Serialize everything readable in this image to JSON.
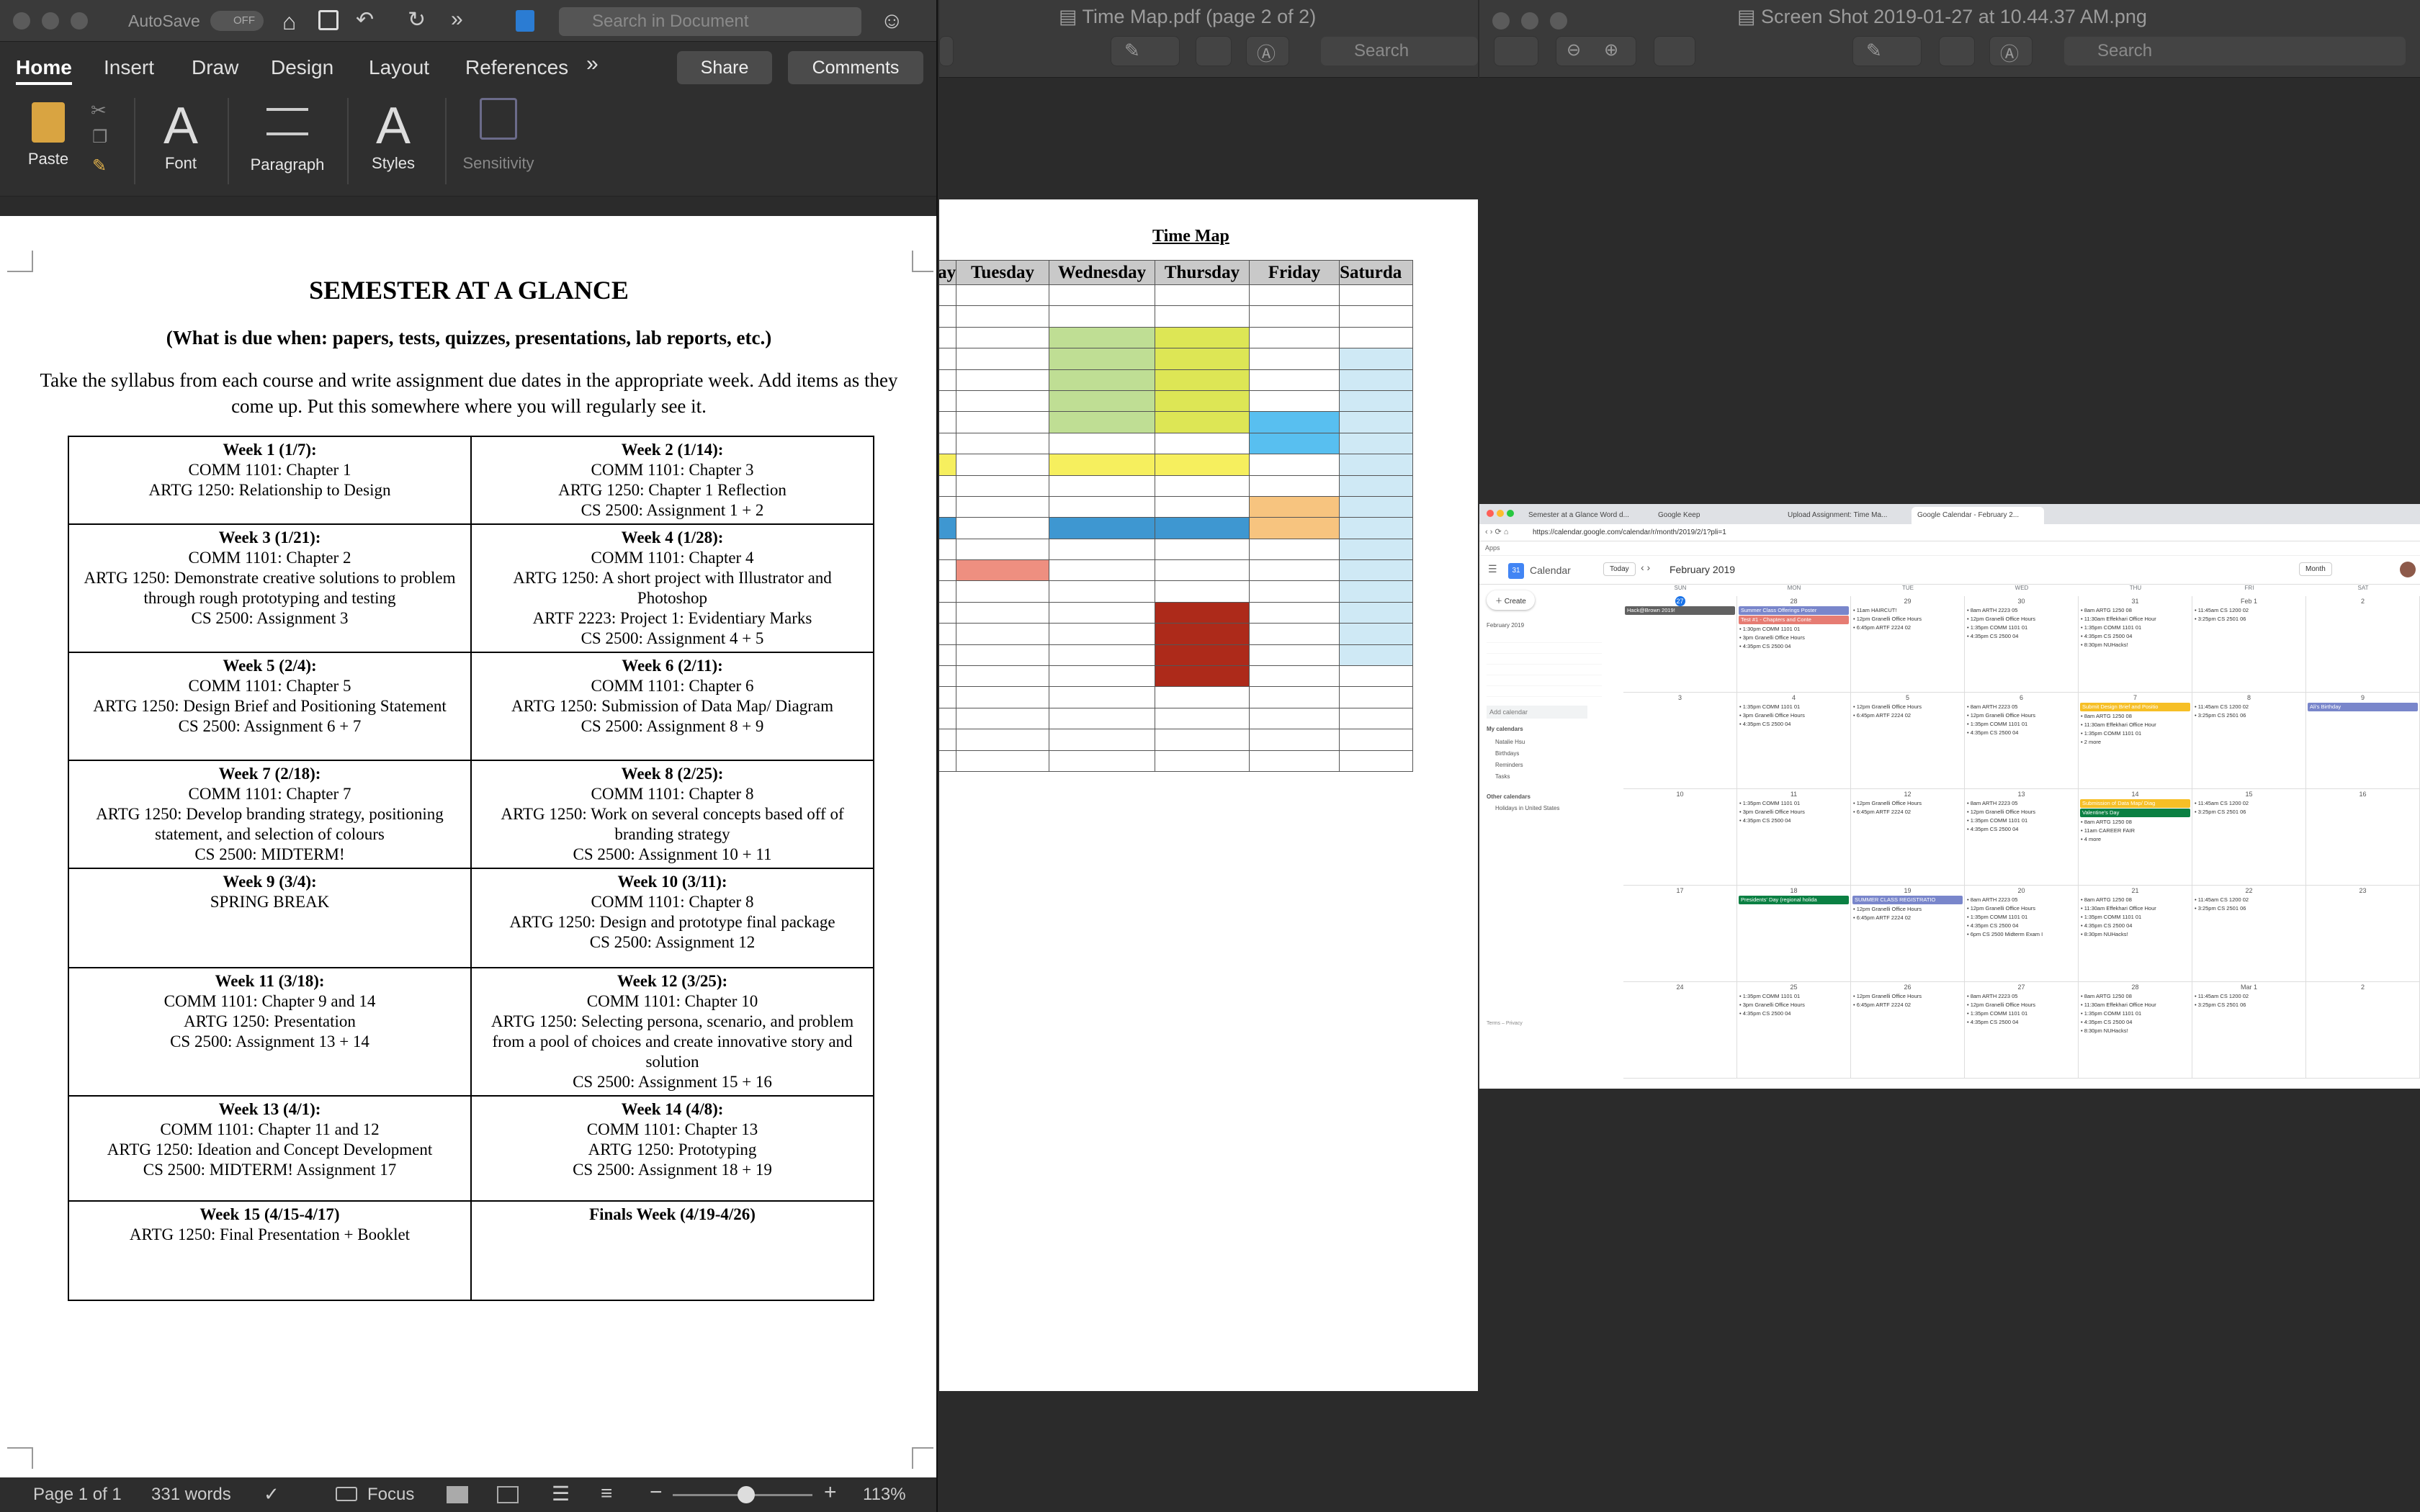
{
  "word": {
    "autosave": "AutoSave",
    "autosave_state": "OFF",
    "search_placeholder": "Search in Document",
    "tabs": [
      "Home",
      "Insert",
      "Draw",
      "Design",
      "Layout",
      "References"
    ],
    "share": "Share",
    "comments": "Comments",
    "ribbon": {
      "paste": "Paste",
      "font": "Font",
      "paragraph": "Paragraph",
      "styles": "Styles",
      "sensitivity": "Sensitivity"
    },
    "doc": {
      "title": "SEMESTER AT A GLANCE",
      "subtitle": "(What is due when:  papers, tests, quizzes, presentations, lab reports, etc.)",
      "intro": "Take the syllabus from each course and write assignment due dates in the appropriate week.  Add items as they come up.  Put this somewhere where you will regularly see it.",
      "weeks": [
        {
          "head": "Week 1 (1/7):",
          "lines": [
            "COMM 1101: Chapter 1",
            "ARTG 1250: Relationship to Design"
          ]
        },
        {
          "head": "Week 2 (1/14):",
          "lines": [
            "COMM 1101: Chapter 3",
            "ARTG 1250: Chapter 1 Reflection",
            "CS 2500: Assignment 1 + 2"
          ]
        },
        {
          "head": "Week 3 (1/21):",
          "lines": [
            "COMM 1101: Chapter 2",
            "ARTG 1250: Demonstrate creative solutions to problem through rough prototyping and testing",
            "CS 2500: Assignment 3"
          ]
        },
        {
          "head": "Week 4 (1/28):",
          "lines": [
            "COMM 1101: Chapter 4",
            "ARTG 1250: A short project with Illustrator and Photoshop",
            "ARTF 2223: Project 1: Evidentiary Marks",
            "CS 2500: Assignment 4 + 5"
          ]
        },
        {
          "head": "Week 5 (2/4):",
          "lines": [
            "COMM 1101: Chapter 5",
            "ARTG 1250: Design Brief and Positioning Statement",
            "CS 2500: Assignment 6 + 7"
          ]
        },
        {
          "head": "Week 6 (2/11):",
          "lines": [
            "COMM 1101: Chapter 6",
            "ARTG 1250: Submission of Data Map/ Diagram",
            "CS 2500: Assignment 8 + 9"
          ]
        },
        {
          "head": "Week 7 (2/18):",
          "lines": [
            "COMM 1101: Chapter 7",
            "ARTG 1250: Develop branding strategy, positioning statement, and selection of colours",
            "CS 2500: MIDTERM!"
          ]
        },
        {
          "head": "Week 8 (2/25):",
          "lines": [
            "COMM 1101: Chapter 8",
            "ARTG 1250: Work on several concepts based off of branding strategy",
            "CS 2500: Assignment 10 + 11"
          ]
        },
        {
          "head": "Week 9 (3/4):",
          "lines": [
            "SPRING BREAK"
          ]
        },
        {
          "head": "Week 10 (3/11):",
          "lines": [
            "COMM 1101: Chapter 8",
            "ARTG 1250: Design and prototype final package",
            "CS 2500: Assignment 12"
          ]
        },
        {
          "head": "Week 11 (3/18):",
          "lines": [
            "COMM 1101: Chapter 9 and 14",
            "ARTG 1250: Presentation",
            "CS 2500: Assignment 13 + 14"
          ]
        },
        {
          "head": "Week 12 (3/25):",
          "lines": [
            "COMM 1101: Chapter 10",
            "ARTG 1250: Selecting persona, scenario, and problem from a pool of choices and create innovative story and solution",
            "CS 2500: Assignment 15 + 16"
          ]
        },
        {
          "head": "Week 13 (4/1):",
          "lines": [
            "COMM 1101: Chapter 11 and 12",
            "ARTG 1250: Ideation and Concept Development",
            "CS 2500: MIDTERM! Assignment 17"
          ]
        },
        {
          "head": "Week 14 (4/8):",
          "lines": [
            "COMM 1101: Chapter 13",
            "ARTG 1250: Prototyping",
            "CS 2500: Assignment 18 + 19"
          ]
        },
        {
          "head": "Week 15 (4/15-4/17)",
          "lines": [
            "ARTG 1250: Final Presentation + Booklet"
          ]
        },
        {
          "head": "Finals Week (4/19-4/26)",
          "lines": []
        }
      ]
    },
    "status": {
      "page": "Page 1 of 1",
      "words": "331 words",
      "focus": "Focus",
      "zoom": "113%"
    }
  },
  "pdf": {
    "window_title": "Time Map.pdf (page 2 of 2)",
    "search_placeholder": "Search",
    "page_title": "Time Map",
    "days": [
      "nday",
      "Tuesday",
      "Wednesday",
      "Thursday",
      "Friday",
      "Saturda"
    ],
    "colors": {
      "green": "#bfde94",
      "lime": "#dde655",
      "lightblue": "#cfe9f5",
      "skyblue": "#58bff0",
      "yellow": "#f6ef5e",
      "blue": "#3e97d1",
      "orange": "#f7c47f",
      "salmon": "#ee8f80",
      "red": "#ad2a1a"
    }
  },
  "preview": {
    "window_title": "Screen Shot 2019-01-27 at 10.44.37 AM.png",
    "search_placeholder": "Search",
    "browser_tabs": [
      "Semester at a Glance Word d...",
      "Google Keep",
      "Upload Assignment: Time Ma...",
      "Google Calendar - February 2..."
    ],
    "url": "https://calendar.google.com/calendar/r/month/2019/2/1?pli=1",
    "apps": "Apps",
    "calendar_label": "Calendar",
    "today": "Today",
    "month_title": "February 2019",
    "view": "Month",
    "create": "Create",
    "mini_month": "February 2019",
    "add_calendar": "Add calendar",
    "my_calendars": "My calendars",
    "my_cal_items": [
      "Natalie Hsu",
      "Birthdays",
      "Reminders",
      "Tasks"
    ],
    "other_calendars": "Other calendars",
    "other_items": [
      "Holidays in United States"
    ],
    "terms": "Terms – Privacy",
    "dow": [
      "SUN",
      "MON",
      "TUE",
      "WED",
      "THU",
      "FRI",
      "SAT"
    ],
    "weeks": [
      [
        {
          "d": "27",
          "ev": [
            {
              "t": "Hack@Brown 2019!",
              "b": "#616161"
            }
          ]
        },
        {
          "d": "28",
          "ev": [
            {
              "t": "Summer Class Offerings Poster",
              "b": "#7986cb"
            },
            {
              "t": "Test #1 - Chapters and Conte",
              "b": "#e67c73"
            },
            {
              "t": "1:30pm COMM 1101 01"
            },
            {
              "t": "3pm Granelli Office Hours"
            },
            {
              "t": "4:35pm CS 2500 04"
            }
          ]
        },
        {
          "d": "29",
          "ev": [
            {
              "t": "11am HAIRCUT!"
            },
            {
              "t": "12pm Granelli Office Hours"
            },
            {
              "t": "6:45pm ARTF 2224 02"
            }
          ]
        },
        {
          "d": "30",
          "ev": [
            {
              "t": "8am ARTH 2223 05"
            },
            {
              "t": "12pm Granelli Office Hours"
            },
            {
              "t": "1:35pm COMM 1101 01"
            },
            {
              "t": "4:35pm CS 2500 04"
            }
          ]
        },
        {
          "d": "31",
          "ev": [
            {
              "t": "8am ARTG 1250 08"
            },
            {
              "t": "11:30am Effekhari Office Hour"
            },
            {
              "t": "1:35pm COMM 1101 01"
            },
            {
              "t": "4:35pm CS 2500 04"
            },
            {
              "t": "8:30pm NUHacks!"
            }
          ]
        },
        {
          "d": "Feb 1",
          "ev": [
            {
              "t": "11:45am CS 1200 02"
            },
            {
              "t": "3:25pm CS 2501 06"
            }
          ]
        },
        {
          "d": "2",
          "ev": []
        }
      ],
      [
        {
          "d": "3",
          "ev": []
        },
        {
          "d": "4",
          "ev": [
            {
              "t": "1:35pm COMM 1101 01"
            },
            {
              "t": "3pm Granelli Office Hours"
            },
            {
              "t": "4:35pm CS 2500 04"
            }
          ]
        },
        {
          "d": "5",
          "ev": [
            {
              "t": "12pm Granelli Office Hours"
            },
            {
              "t": "6:45pm ARTF 2224 02"
            }
          ]
        },
        {
          "d": "6",
          "ev": [
            {
              "t": "8am ARTH 2223 05"
            },
            {
              "t": "12pm Granelli Office Hours"
            },
            {
              "t": "1:35pm COMM 1101 01"
            },
            {
              "t": "4:35pm CS 2500 04"
            }
          ]
        },
        {
          "d": "7",
          "ev": [
            {
              "t": "Submit Design Brief and Positio",
              "b": "#f6bf26"
            },
            {
              "t": "8am ARTG 1250 08"
            },
            {
              "t": "11:30am Effekhari Office Hour"
            },
            {
              "t": "1:35pm COMM 1101 01"
            },
            {
              "t": "2 more"
            }
          ]
        },
        {
          "d": "8",
          "ev": [
            {
              "t": "11:45am CS 1200 02"
            },
            {
              "t": "3:25pm CS 2501 06"
            }
          ]
        },
        {
          "d": "9",
          "ev": [
            {
              "t": "Ali's Birthday",
              "b": "#7986cb"
            }
          ]
        }
      ],
      [
        {
          "d": "10",
          "ev": []
        },
        {
          "d": "11",
          "ev": [
            {
              "t": "1:35pm COMM 1101 01"
            },
            {
              "t": "3pm Granelli Office Hours"
            },
            {
              "t": "4:35pm CS 2500 04"
            }
          ]
        },
        {
          "d": "12",
          "ev": [
            {
              "t": "12pm Granelli Office Hours"
            },
            {
              "t": "6:45pm ARTF 2224 02"
            }
          ]
        },
        {
          "d": "13",
          "ev": [
            {
              "t": "8am ARTH 2223 05"
            },
            {
              "t": "12pm Granelli Office Hours"
            },
            {
              "t": "1:35pm COMM 1101 01"
            },
            {
              "t": "4:35pm CS 2500 04"
            }
          ]
        },
        {
          "d": "14",
          "ev": [
            {
              "t": "Submission of Data Map/ Diag",
              "b": "#f6bf26"
            },
            {
              "t": "Valentine's Day",
              "b": "#0b8043"
            },
            {
              "t": "8am ARTG 1250 08"
            },
            {
              "t": "11am CAREER FAIR"
            },
            {
              "t": "4 more"
            }
          ]
        },
        {
          "d": "15",
          "ev": [
            {
              "t": "11:45am CS 1200 02"
            },
            {
              "t": "3:25pm CS 2501 06"
            }
          ]
        },
        {
          "d": "16",
          "ev": []
        }
      ],
      [
        {
          "d": "17",
          "ev": []
        },
        {
          "d": "18",
          "ev": [
            {
              "t": "Presidents' Day (regional holida",
              "b": "#0b8043"
            }
          ]
        },
        {
          "d": "19",
          "ev": [
            {
              "t": "SUMMER CLASS REGISTRATIO",
              "b": "#7986cb"
            },
            {
              "t": "12pm Granelli Office Hours"
            },
            {
              "t": "6:45pm ARTF 2224 02"
            }
          ]
        },
        {
          "d": "20",
          "ev": [
            {
              "t": "8am ARTH 2223 05"
            },
            {
              "t": "12pm Granelli Office Hours"
            },
            {
              "t": "1:35pm COMM 1101 01"
            },
            {
              "t": "4:35pm CS 2500 04"
            },
            {
              "t": "6pm CS 2500 Midterm Exam I"
            }
          ]
        },
        {
          "d": "21",
          "ev": [
            {
              "t": "8am ARTG 1250 08"
            },
            {
              "t": "11:30am Effekhari Office Hour"
            },
            {
              "t": "1:35pm COMM 1101 01"
            },
            {
              "t": "4:35pm CS 2500 04"
            },
            {
              "t": "8:30pm NUHacks!"
            }
          ]
        },
        {
          "d": "22",
          "ev": [
            {
              "t": "11:45am CS 1200 02"
            },
            {
              "t": "3:25pm CS 2501 06"
            }
          ]
        },
        {
          "d": "23",
          "ev": []
        }
      ],
      [
        {
          "d": "24",
          "ev": []
        },
        {
          "d": "25",
          "ev": [
            {
              "t": "1:35pm COMM 1101 01"
            },
            {
              "t": "3pm Granelli Office Hours"
            },
            {
              "t": "4:35pm CS 2500 04"
            }
          ]
        },
        {
          "d": "26",
          "ev": [
            {
              "t": "12pm Granelli Office Hours"
            },
            {
              "t": "6:45pm ARTF 2224 02"
            }
          ]
        },
        {
          "d": "27",
          "ev": [
            {
              "t": "8am ARTH 2223 05"
            },
            {
              "t": "12pm Granelli Office Hours"
            },
            {
              "t": "1:35pm COMM 1101 01"
            },
            {
              "t": "4:35pm CS 2500 04"
            }
          ]
        },
        {
          "d": "28",
          "ev": [
            {
              "t": "8am ARTG 1250 08"
            },
            {
              "t": "11:30am Effekhari Office Hour"
            },
            {
              "t": "1:35pm COMM 1101 01"
            },
            {
              "t": "4:35pm CS 2500 04"
            },
            {
              "t": "8:30pm NUHacks!"
            }
          ]
        },
        {
          "d": "Mar 1",
          "ev": [
            {
              "t": "11:45am CS 1200 02"
            },
            {
              "t": "3:25pm CS 2501 06"
            }
          ]
        },
        {
          "d": "2",
          "ev": []
        }
      ]
    ]
  }
}
